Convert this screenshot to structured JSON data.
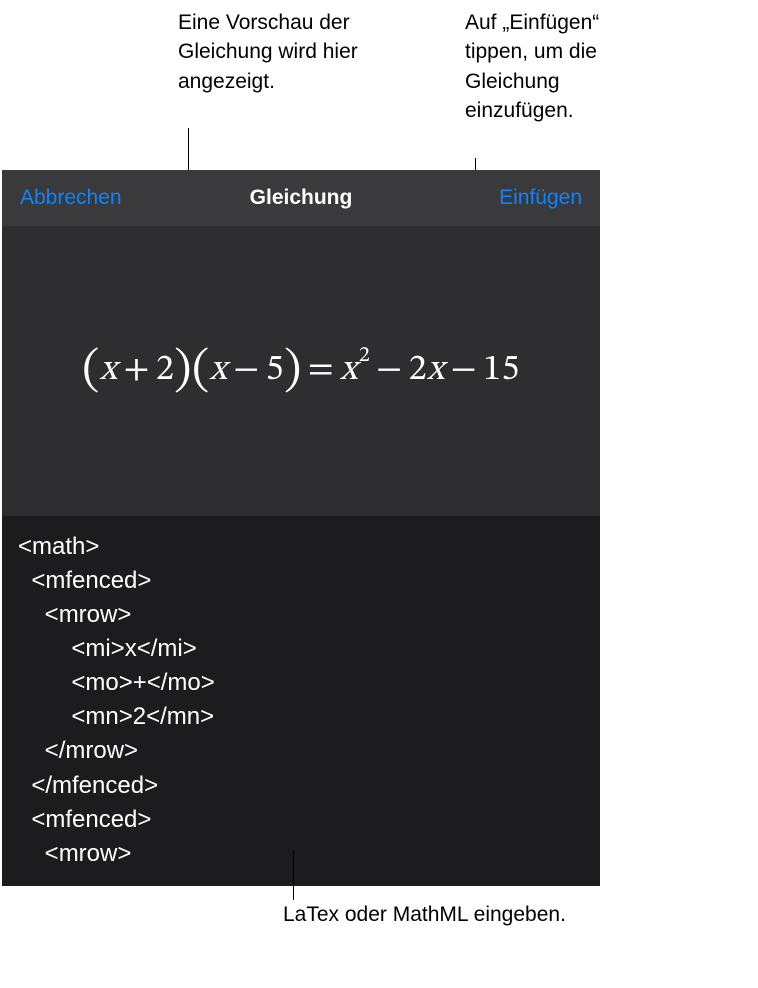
{
  "callouts": {
    "preview": "Eine Vorschau der Gleichung wird hier angezeigt.",
    "insert": "Auf „Einfügen“ tippen, um die Gleichung einzufügen.",
    "input": "LaTex oder MathML eingeben."
  },
  "panel": {
    "cancel_label": "Abbrechen",
    "title": "Gleichung",
    "insert_label": "Einfügen"
  },
  "equation": {
    "lparen1": "(",
    "x1": "x",
    "plus1": "+",
    "two": "2",
    "rparen1": ")",
    "lparen2": "(",
    "x2": "x",
    "minus1": "−",
    "five": "5",
    "rparen2": ")",
    "eq": "=",
    "x3": "x",
    "exp": "2",
    "minus2": "−",
    "coef2": "2",
    "x4": "x",
    "minus3": "−",
    "fifteen": "15"
  },
  "code": "<math>\n  <mfenced>\n    <mrow>\n        <mi>x</mi>\n        <mo>+</mo>\n        <mn>2</mn>\n    </mrow>\n  </mfenced>\n  <mfenced>\n    <mrow>"
}
